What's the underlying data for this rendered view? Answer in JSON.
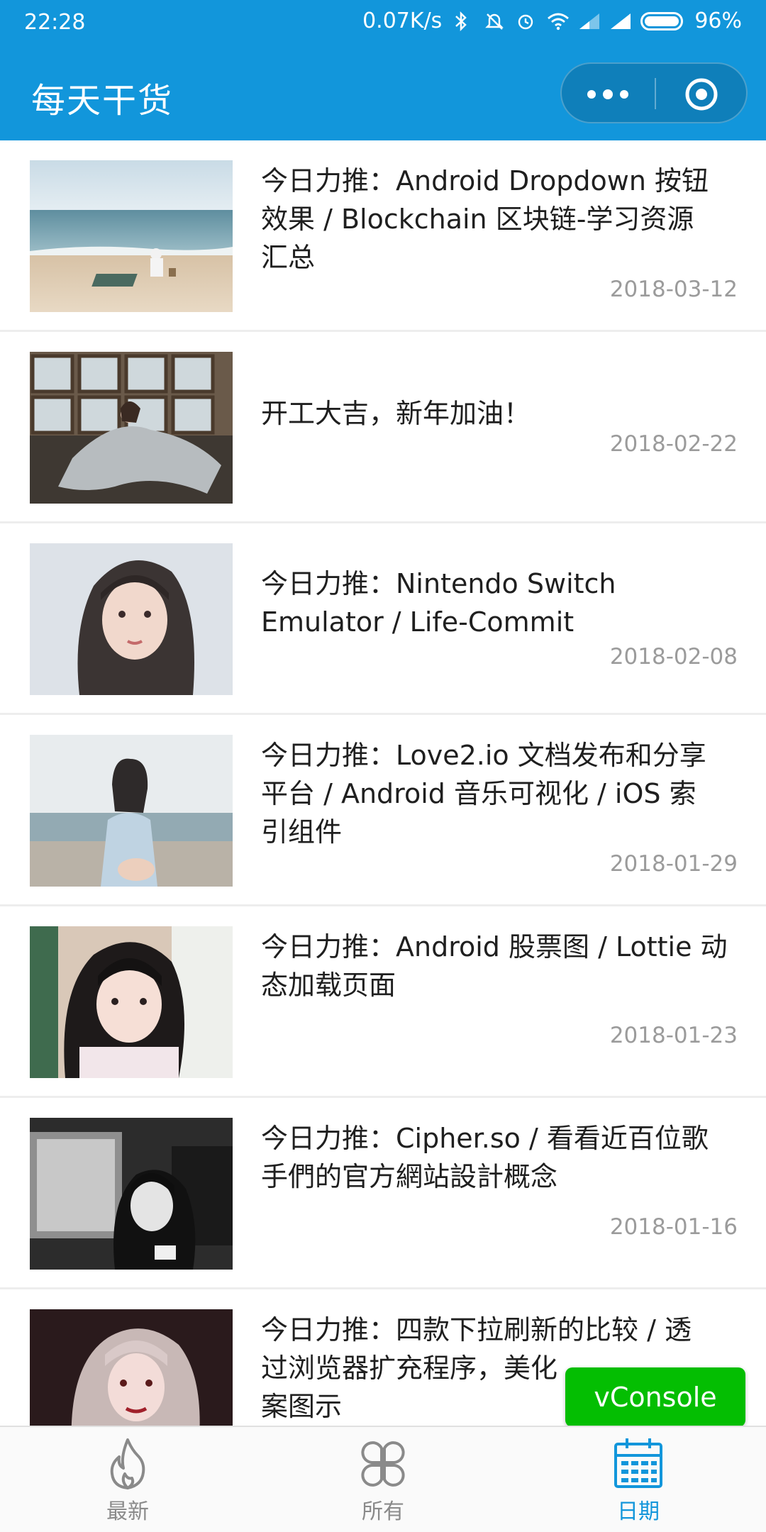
{
  "status_bar": {
    "time": "22:28",
    "net_speed": "0.07K/s",
    "battery": "96%",
    "icons": [
      "bluetooth-icon",
      "mute-icon",
      "alarm-icon",
      "wifi-icon",
      "signal-icon",
      "signal-icon",
      "battery-icon"
    ]
  },
  "header": {
    "title": "每天干货"
  },
  "articles": [
    {
      "title": "今日力推：Android Dropdown 按钮效果 / Blockchain 区块链-学习资源汇总",
      "line1": "今日力推：Android Dropdown 按钮",
      "line2": "效果 / Blockchain 区块链-学习资源",
      "line3": "汇总",
      "date": "2018-03-12"
    },
    {
      "title": "开工大吉，新年加油！",
      "line1": "开工大吉，新年加油！",
      "line2": "",
      "line3": "",
      "date": "2018-02-22"
    },
    {
      "title": "今日力推：Nintendo Switch Emulator / Life-Commit",
      "line1": "今日力推：Nintendo Switch",
      "line2": "Emulator / Life-Commit",
      "line3": "",
      "date": "2018-02-08"
    },
    {
      "title": "今日力推：Love2.io 文档发布和分享平台 / Android 音乐可视化 / iOS 索引组件",
      "line1": "今日力推：Love2.io 文档发布和分享",
      "line2": "平台 / Android 音乐可视化 / iOS 索",
      "line3": "引组件",
      "date": "2018-01-29"
    },
    {
      "title": "今日力推：Android 股票图 / Lottie 动态加载页面",
      "line1": "今日力推：Android 股票图 / Lottie 动",
      "line2": "态加载页面",
      "line3": "",
      "date": "2018-01-23"
    },
    {
      "title": "今日力推：Cipher.so / 看看近百位歌手們的官方網站設計概念",
      "line1": "今日力推：Cipher.so / 看看近百位歌",
      "line2": "手們的官方網站設計概念",
      "line3": "",
      "date": "2018-01-16"
    },
    {
      "title": "今日力推：四款下拉刷新的比较 / 透过浏览器扩充程序，美化…案图示",
      "line1": "今日力推：四款下拉刷新的比较 / 透",
      "line2": "过浏览器扩充程序，美化",
      "line3": "案图示",
      "date": ""
    }
  ],
  "vconsole": {
    "label": "vConsole"
  },
  "tabbar": {
    "tabs": [
      {
        "label": "最新",
        "icon": "flame-icon",
        "active": false
      },
      {
        "label": "所有",
        "icon": "clover-grid-icon",
        "active": false
      },
      {
        "label": "日期",
        "icon": "calendar-icon",
        "active": true
      }
    ]
  },
  "colors": {
    "primary": "#1296db",
    "vconsole": "#04be02",
    "date_text": "#9b9b9b",
    "tab_inactive": "#8a8a8a"
  }
}
